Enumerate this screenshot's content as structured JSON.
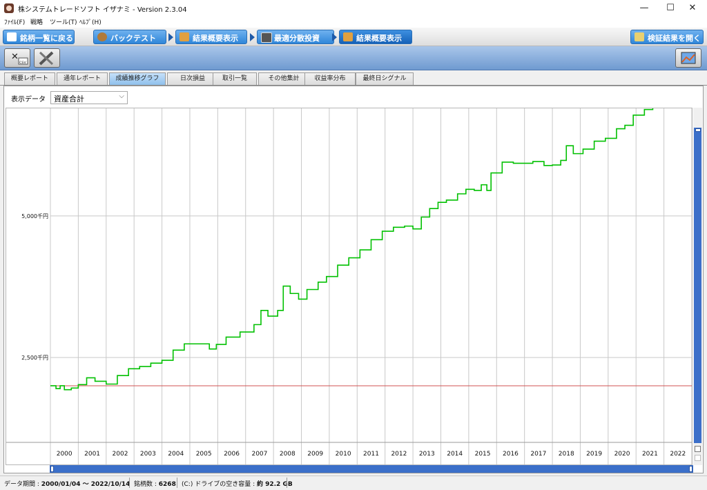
{
  "window": {
    "title": "株システムトレードソフト イザナミ - Version 2.3.04",
    "minimize": "—",
    "maximize": "☐",
    "close": "✕"
  },
  "menu": [
    "ﾌｧｲﾙ(F)",
    "戦略",
    "ツール(T)",
    "ﾍﾙﾌﾟ(H)"
  ],
  "nav": {
    "back": "銘柄一覧に戻る",
    "steps": [
      "バックテスト",
      "結果概要表示",
      "最適分散投資",
      "結果概要表示"
    ],
    "open_results": "検証結果を開く"
  },
  "toolbar": {
    "csv_icon": "excel-csv-icon",
    "tools_icon": "tools-icon",
    "right_icon": "image-export-icon"
  },
  "tabs": [
    "概要レポート",
    "通年レポート",
    "成績推移グラフ",
    "日次損益",
    "取引一覧",
    "その他集計",
    "収益率分布",
    "最終日シグナル"
  ],
  "active_tab": 2,
  "display": {
    "label": "表示データ",
    "selected": "資産合計"
  },
  "colors": {
    "line": "#00c000",
    "baseline": "#d05050",
    "grid": "#c8c8c8",
    "accent": "#3b6fc9"
  },
  "chart_data": {
    "type": "line",
    "title": "",
    "xlabel": "",
    "ylabel": "",
    "y_ticks": [
      {
        "value": 5000,
        "label": "5,000千円"
      },
      {
        "value": 2500,
        "label": "2,500千円"
      }
    ],
    "x_categories": [
      "2000",
      "2001",
      "2002",
      "2003",
      "2004",
      "2005",
      "2006",
      "2007",
      "2008",
      "2009",
      "2010",
      "2011",
      "2012",
      "2013",
      "2014",
      "2015",
      "2016",
      "2017",
      "2018",
      "2019",
      "2020",
      "2021",
      "2022"
    ],
    "ylim": [
      1000,
      6900
    ],
    "baseline": 2000,
    "grid": true,
    "series": [
      {
        "color": "#00c000",
        "points": [
          [
            2000.0,
            2000
          ],
          [
            2000.2,
            1950
          ],
          [
            2000.35,
            2000
          ],
          [
            2000.5,
            1930
          ],
          [
            2000.75,
            1960
          ],
          [
            2001.0,
            2020
          ],
          [
            2001.3,
            2140
          ],
          [
            2001.6,
            2080
          ],
          [
            2002.0,
            2030
          ],
          [
            2002.4,
            2180
          ],
          [
            2002.8,
            2300
          ],
          [
            2003.2,
            2340
          ],
          [
            2003.6,
            2400
          ],
          [
            2004.0,
            2450
          ],
          [
            2004.4,
            2630
          ],
          [
            2004.8,
            2740
          ],
          [
            2005.3,
            2740
          ],
          [
            2005.7,
            2650
          ],
          [
            2005.95,
            2730
          ],
          [
            2006.3,
            2860
          ],
          [
            2006.8,
            2950
          ],
          [
            2007.3,
            3080
          ],
          [
            2007.55,
            3330
          ],
          [
            2007.8,
            3230
          ],
          [
            2008.15,
            3330
          ],
          [
            2008.35,
            3760
          ],
          [
            2008.6,
            3630
          ],
          [
            2008.9,
            3530
          ],
          [
            2009.2,
            3700
          ],
          [
            2009.6,
            3830
          ],
          [
            2009.9,
            3930
          ],
          [
            2010.3,
            4130
          ],
          [
            2010.7,
            4260
          ],
          [
            2011.1,
            4400
          ],
          [
            2011.5,
            4580
          ],
          [
            2011.9,
            4730
          ],
          [
            2012.3,
            4800
          ],
          [
            2012.7,
            4820
          ],
          [
            2013.0,
            4770
          ],
          [
            2013.3,
            4980
          ],
          [
            2013.6,
            5130
          ],
          [
            2013.9,
            5240
          ],
          [
            2014.2,
            5280
          ],
          [
            2014.6,
            5390
          ],
          [
            2014.9,
            5470
          ],
          [
            2015.2,
            5450
          ],
          [
            2015.45,
            5550
          ],
          [
            2015.65,
            5450
          ],
          [
            2015.8,
            5760
          ],
          [
            2016.2,
            5950
          ],
          [
            2016.6,
            5930
          ],
          [
            2016.9,
            5930
          ],
          [
            2017.3,
            5960
          ],
          [
            2017.7,
            5890
          ],
          [
            2018.0,
            5900
          ],
          [
            2018.3,
            5980
          ],
          [
            2018.5,
            6240
          ],
          [
            2018.75,
            6100
          ],
          [
            2019.1,
            6180
          ],
          [
            2019.5,
            6320
          ],
          [
            2019.9,
            6370
          ],
          [
            2020.3,
            6540
          ],
          [
            2020.6,
            6600
          ],
          [
            2020.9,
            6780
          ],
          [
            2021.3,
            6880
          ],
          [
            2021.6,
            6990
          ],
          [
            2021.8,
            7100
          ],
          [
            2022.0,
            6960
          ],
          [
            2022.3,
            6990
          ],
          [
            2022.45,
            7030
          ]
        ]
      }
    ]
  },
  "status": {
    "period_label": "データ期間",
    "period_value": "2000/01/04 〜 2022/10/14",
    "stocks_label": "銘柄数",
    "stocks_value": "6268",
    "disk_label": "(C:) ドライブの空き容量",
    "disk_value": "約 92.2 GB"
  }
}
